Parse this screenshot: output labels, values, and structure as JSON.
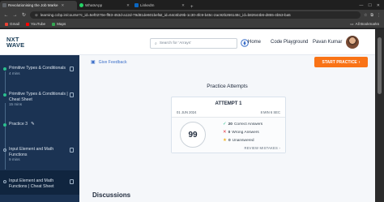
{
  "browser": {
    "tabs": [
      {
        "label": "Revolutionising the Job Marke",
        "color": "#5f6368",
        "active": true
      },
      {
        "label": "WhatsApp",
        "color": "#25d366",
        "active": false
      },
      {
        "label": "LinkedIn",
        "color": "#0a66c2",
        "active": false
      }
    ],
    "url": "learning.ccbp.in/course?c_id=5ef0270e-ff83-453d-a12d-79d81de601bef&t_id=64c6b29b-1c30-4fc9-b45c-2ac92b266148c_id=b82644b6-d855-4b53-ba5",
    "bookmarks": [
      {
        "label": "Gmail",
        "color": "#ea4335"
      },
      {
        "label": "YouTube",
        "color": "#ff0000"
      },
      {
        "label": "Maps",
        "color": "#34a853"
      }
    ],
    "all_bookmarks": "All Bookmarks"
  },
  "header": {
    "logo_line1": "NXT",
    "logo_line2": "WAVE",
    "search_placeholder": "Search for 'Arrays'",
    "nav": [
      "Home",
      "Code Playground"
    ],
    "user_name": "Pavan Kumar"
  },
  "sidebar": {
    "items": [
      {
        "title": "Primitive Types & Conditionals",
        "meta": "4 mins",
        "status": "done"
      },
      {
        "title": "Primitive Types & Conditionals | Cheat Sheet",
        "meta": "15 mins",
        "status": "done"
      },
      {
        "title": "Practice 3",
        "meta": "",
        "status": "active"
      },
      {
        "title": "Input Element and Math Functions",
        "meta": "9 mins",
        "status": "todo"
      },
      {
        "title": "Input Element and Math Functions | Cheat Sheet",
        "meta": "",
        "status": "todo"
      }
    ]
  },
  "main": {
    "feedback": "Give Feedback",
    "start_button": "START PRACTICE",
    "section_title": "Practice Attempts",
    "attempt": {
      "title": "ATTEMPT 1",
      "date": "01 JUN 2024",
      "duration": "8 MIN 6 SEC",
      "score": "99",
      "correct": "20",
      "correct_label": "Correct Answers",
      "wrong": "0",
      "wrong_label": "Wrong Answers",
      "unanswered": "0",
      "unanswered_label": "Unanswered",
      "review": "REVIEW MISTAKES"
    },
    "discussions": "Discussions"
  },
  "colors": {
    "sidebar_bg": "#1b3353",
    "accent_orange": "#f97316",
    "done_green": "#2bbf8e",
    "link_blue": "#3b6fc9"
  }
}
